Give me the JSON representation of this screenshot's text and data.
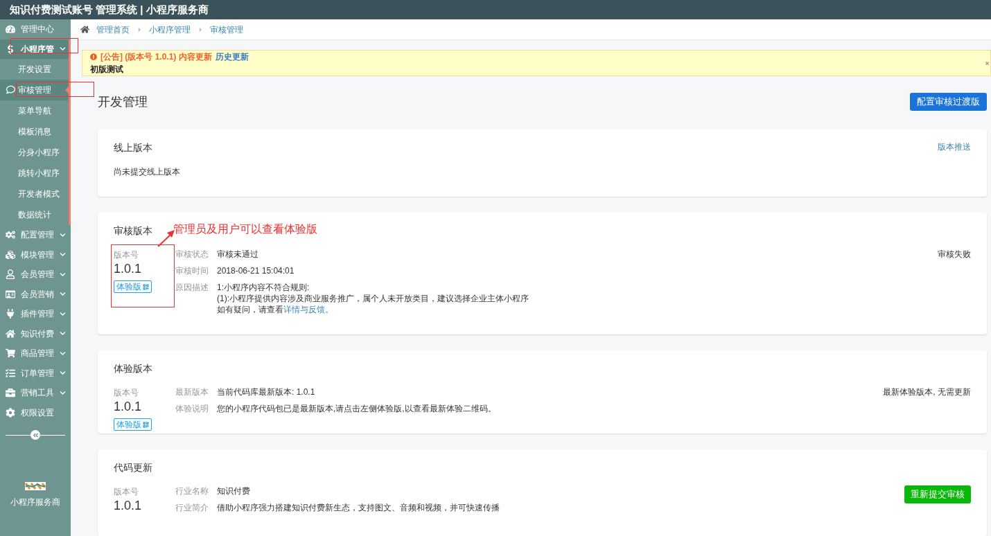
{
  "window": {
    "title": "知识付费测试账号 管理系统 | 小程序服务商"
  },
  "sidebar": {
    "items": [
      {
        "label": "管理中心",
        "has_submenu": false,
        "expanded": false
      },
      {
        "label": "小程序管",
        "has_submenu": true,
        "expanded": true,
        "children": [
          {
            "label": "开发设置",
            "selected": false
          },
          {
            "label": "审核管理",
            "selected": true
          },
          {
            "label": "菜单导航",
            "selected": false
          },
          {
            "label": "模板消息",
            "selected": false
          },
          {
            "label": "分身小程序",
            "selected": false
          },
          {
            "label": "跳转小程序",
            "selected": false
          },
          {
            "label": "开发者模式",
            "selected": false
          },
          {
            "label": "数据统计",
            "selected": false
          }
        ]
      },
      {
        "label": "配置管理",
        "has_submenu": true,
        "expanded": false
      },
      {
        "label": "模块管理",
        "has_submenu": true,
        "expanded": false
      },
      {
        "label": "会员管理",
        "has_submenu": true,
        "expanded": false
      },
      {
        "label": "会员营销",
        "has_submenu": true,
        "expanded": false
      },
      {
        "label": "插件管理",
        "has_submenu": true,
        "expanded": false
      },
      {
        "label": "知识付费",
        "has_submenu": true,
        "expanded": false
      },
      {
        "label": "商品管理",
        "has_submenu": true,
        "expanded": false
      },
      {
        "label": "订单管理",
        "has_submenu": true,
        "expanded": false
      },
      {
        "label": "营销工具",
        "has_submenu": true,
        "expanded": false
      },
      {
        "label": "权限设置",
        "has_submenu": false,
        "expanded": false
      }
    ],
    "brand": "小程序服务商"
  },
  "breadcrumb": [
    "管理首页",
    "小程序管理",
    "审核管理"
  ],
  "notice": {
    "title": "[公告] (版本号 1.0.1) 内容更新",
    "link": "历史更新",
    "body": "初版测试"
  },
  "page": {
    "title": "开发管理",
    "action": "配置审核过渡版"
  },
  "cards": [
    {
      "kind": "empty",
      "title": "线上版本",
      "action": {
        "kind": "link",
        "label": "版本推送"
      },
      "message": "尚未提交线上版本"
    },
    {
      "kind": "version",
      "title": "审核版本",
      "annotation": "管理员及用户可以查看体验版",
      "version_label": "版本号",
      "version": "1.0.1",
      "preview_button": "体验版",
      "details": [
        {
          "label": "审核状态",
          "lines": [
            "审核未通过"
          ]
        },
        {
          "label": "审核时间",
          "lines": [
            "2018-06-21 15:04:01"
          ]
        },
        {
          "label": "原因描述",
          "lines": [
            "1:小程序内容不符合规则:",
            "(1):小程序提供内容涉及商业服务推广，属个人未开放类目，建议选择企业主体小程序"
          ],
          "help": {
            "text": "如有疑问，请查看",
            "link": "详情与反馈。"
          }
        }
      ],
      "action": {
        "kind": "text",
        "label": "审核失败"
      }
    },
    {
      "kind": "version",
      "title": "体验版本",
      "version_label": "版本号",
      "version": "1.0.1",
      "preview_button": "体验版",
      "details": [
        {
          "label": "最新版本",
          "lines": [
            "当前代码库最新版本: 1.0.1"
          ]
        },
        {
          "label": "体验说明",
          "lines": [
            "您的小程序代码包已是最新版本,请点击左侧体验版,以查看最新体验二维码。"
          ]
        }
      ],
      "action": {
        "kind": "text",
        "label": "最新体验版本, 无需更新"
      }
    },
    {
      "kind": "version",
      "title": "代码更新",
      "version_label": "版本号",
      "version": "1.0.1",
      "details": [
        {
          "label": "行业名称",
          "lines": [
            "知识付费"
          ]
        },
        {
          "label": "行业简介",
          "lines": [
            "借助小程序强力搭建知识付费新生态，支持图文、音频和视频，并可快速传播"
          ]
        }
      ],
      "action": {
        "kind": "button",
        "label": "重新提交审核"
      }
    }
  ]
}
